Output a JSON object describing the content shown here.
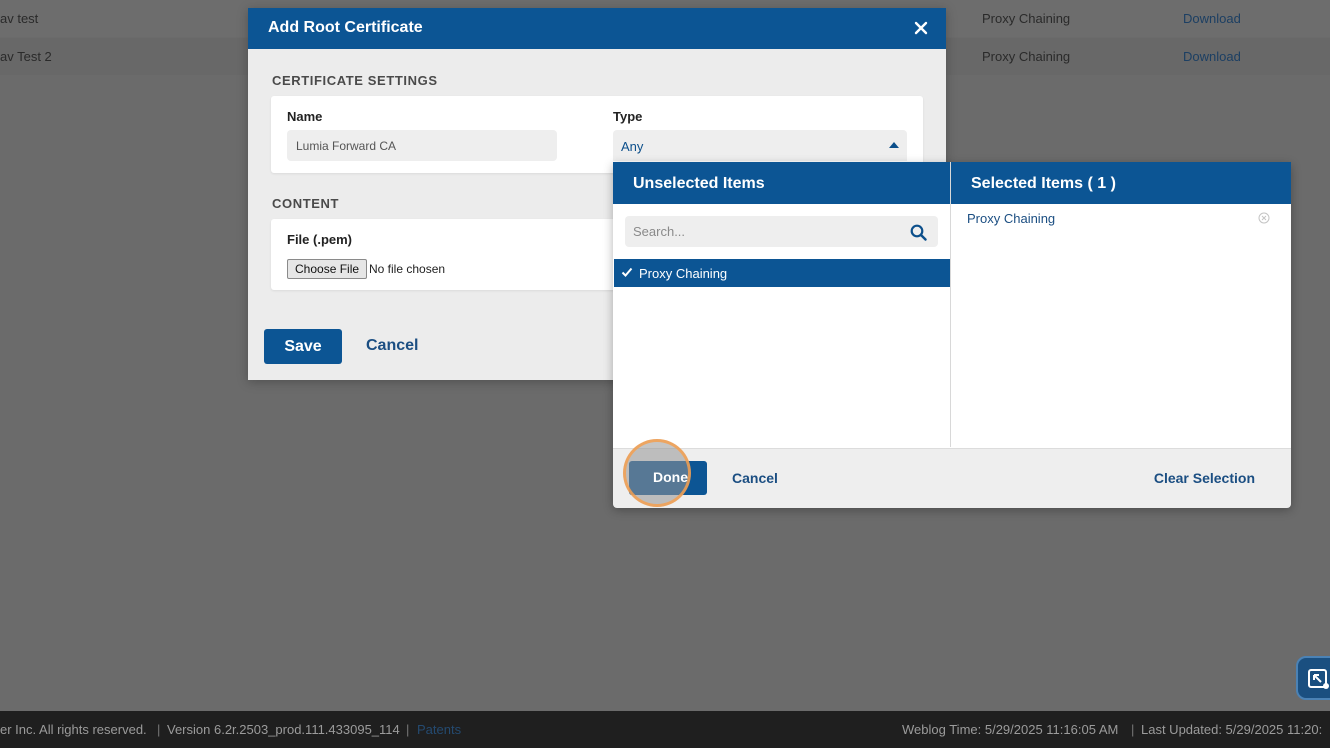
{
  "background_table": {
    "rows": [
      {
        "name": "av test",
        "type": "Proxy Chaining",
        "action": "Download"
      },
      {
        "name": "av Test 2",
        "type": "Proxy Chaining",
        "action": "Download"
      }
    ]
  },
  "dialog": {
    "title": "Add Root Certificate",
    "close_icon": "close-icon",
    "settings_section": "CERTIFICATE SETTINGS",
    "name_label": "Name",
    "name_value": "Lumia Forward CA",
    "type_label": "Type",
    "type_value": "Any",
    "content_section": "CONTENT",
    "file_label": "File (.pem)",
    "choose_file": "Choose File",
    "file_status": "No file chosen",
    "save": "Save",
    "cancel": "Cancel"
  },
  "picker": {
    "unselected_title": "Unselected Items",
    "selected_title": "Selected Items ( 1 )",
    "search_placeholder": "Search...",
    "unselected_items": [
      "Proxy Chaining"
    ],
    "selected_items": [
      "Proxy Chaining"
    ],
    "done": "Done",
    "cancel": "Cancel",
    "clear_selection": "Clear Selection"
  },
  "footer": {
    "copyright": "er Inc. All rights reserved.",
    "version": "Version 6.2r.2503_prod.111.433095_114",
    "patents": "Patents",
    "weblog_time": "Weblog Time: 5/29/2025 11:16:05 AM",
    "last_updated": "Last Updated: 5/29/2025 11:20:"
  },
  "colors": {
    "primary": "#0c5594",
    "link": "#1b4e82",
    "overlay": "#6b6b6b",
    "highlight_ring": "#f5a050"
  }
}
